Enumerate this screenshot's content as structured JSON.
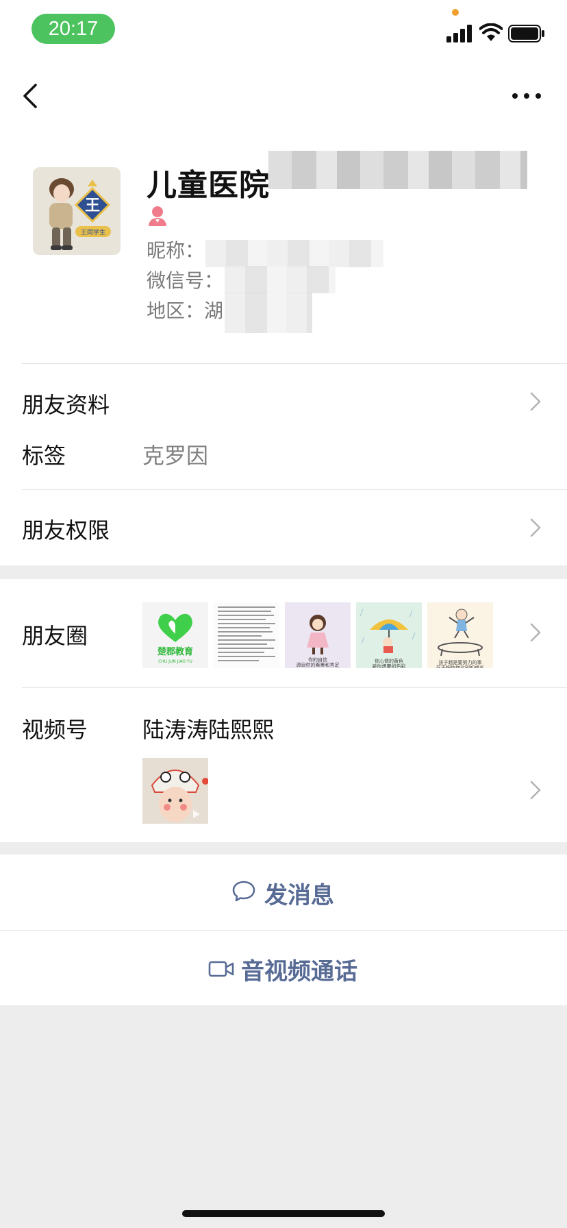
{
  "status_bar": {
    "time": "20:17"
  },
  "nav": {
    "back_icon": "chevron-left-icon",
    "more_icon": "more-dots-icon"
  },
  "profile": {
    "display_name": "儿童医院",
    "gender_icon": "female-person-icon",
    "nickname_label": "昵称：",
    "wechat_id_label": "微信号：",
    "region_label": "地区：",
    "region_value": "湖"
  },
  "cells": {
    "friend_info": "朋友资料",
    "tags_label": "标签",
    "tags_value": "克罗因",
    "friend_permissions": "朋友权限",
    "moments_label": "朋友圈",
    "channels_label": "视频号",
    "channels_name": "陆涛涛陆熙熙"
  },
  "moments_thumbs": {
    "brand_text": "楚郡教育",
    "brand_sub": "CHU JUN JIAO YU",
    "caption_1": "你的自信\n源自你的看重和肯定",
    "caption_2": "你心情的黄色\n是你想要的色彩",
    "caption_3": "孩子越是要努力的事\n在不相信你比别的成长"
  },
  "avatar_text": {
    "badge_char": "王",
    "badge_sub": "王同学生"
  },
  "actions": {
    "send_message": "发消息",
    "send_message_icon": "chat-bubble-icon",
    "av_call": "音视频通话",
    "av_call_icon": "video-camera-icon"
  },
  "colors": {
    "accent_link": "#576b95",
    "time_pill": "#4cc35e",
    "background": "#ededed"
  }
}
